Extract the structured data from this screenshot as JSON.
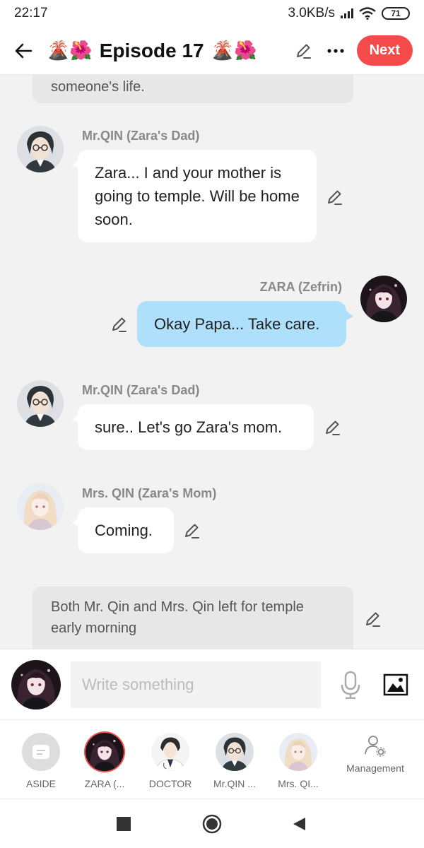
{
  "status_bar": {
    "time": "22:17",
    "network_speed": "3.0KB/s",
    "battery": "71"
  },
  "header": {
    "title": "Episode 17",
    "title_emoji_left": "🌋🌺",
    "title_emoji_right": "🌋🌺",
    "next_label": "Next"
  },
  "chat": {
    "messages": [
      {
        "type": "narration",
        "text": "someone's life."
      },
      {
        "type": "left",
        "speaker": "Mr.QIN (Zara's Dad)",
        "text": "Zara... I and your mother is going to temple. Will be home soon."
      },
      {
        "type": "right",
        "speaker": "ZARA (Zefrin)",
        "text": "Okay Papa... Take care."
      },
      {
        "type": "left",
        "speaker": "Mr.QIN (Zara's Dad)",
        "text": "sure.. Let's go Zara's mom."
      },
      {
        "type": "left",
        "speaker": "Mrs. QIN (Zara's Mom)",
        "text": "Coming."
      },
      {
        "type": "narration",
        "text": "Both Mr. Qin and Mrs. Qin left for temple early morning"
      }
    ]
  },
  "input": {
    "placeholder": "Write something"
  },
  "characters": [
    {
      "label": "ASIDE"
    },
    {
      "label": "ZARA (..."
    },
    {
      "label": "DOCTOR"
    },
    {
      "label": "Mr.QIN ..."
    },
    {
      "label": "Mrs. QI..."
    },
    {
      "label": "Management"
    }
  ],
  "colors": {
    "accent": "#f54b4b",
    "right_bubble": "#aee0fb",
    "background": "#f2f2f2"
  }
}
